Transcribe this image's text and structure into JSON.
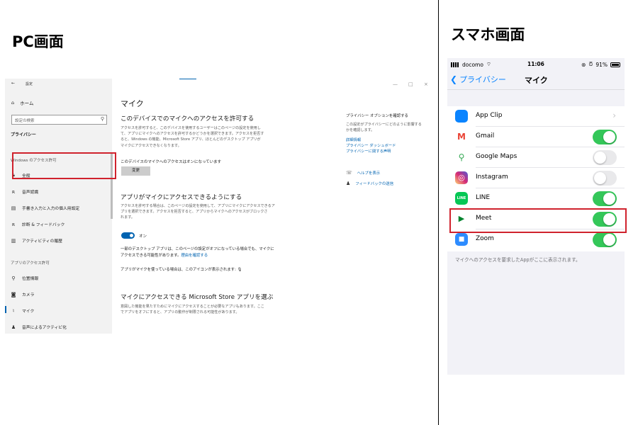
{
  "headings": {
    "pc": "PC画面",
    "smartphone": "スマホ画面"
  },
  "pc": {
    "window_title": "設定",
    "window_controls": {
      "minimize": "—",
      "maximize": "□",
      "close": "×"
    },
    "sidebar": {
      "back": "←",
      "home": "ホーム",
      "search_placeholder": "設定の検索",
      "current": "プライバシー",
      "section_windows": "Windows のアクセス許可",
      "windows_items": [
        {
          "label": "全般",
          "icon": "lock-icon"
        },
        {
          "label": "音声認識",
          "icon": "voice-icon"
        },
        {
          "label": "手書き入力と入力の個人用設定",
          "icon": "handwriting-icon"
        },
        {
          "label": "診断 & フィードバック",
          "icon": "diagnostics-icon"
        },
        {
          "label": "アクティビティの履歴",
          "icon": "history-icon"
        }
      ],
      "section_apps": "アプリのアクセス許可",
      "app_items": [
        {
          "label": "位置情報",
          "icon": "location-icon"
        },
        {
          "label": "カメラ",
          "icon": "camera-icon"
        },
        {
          "label": "マイク",
          "icon": "microphone-icon"
        },
        {
          "label": "音声によるアクティビ化",
          "icon": "voice-activation-icon"
        }
      ]
    },
    "main": {
      "title": "マイク",
      "device_heading": "このデバイスでのマイクへのアクセスを許可する",
      "device_desc": [
        "アクセスを許可すると、このデバイスを使用するユーザーはこのページの設定を使用し",
        "て、アプリにマイクへのアクセスを許可するかどうかを選択できます。アクセスを拒否す",
        "ると、Windows の機能、Microsoft Store アプリ、ほとんどのデスクトップ アプリが",
        "マイクにアクセスできなくなります。"
      ],
      "device_status": "このデバイスのマイクへのアクセスはオンになっています",
      "change_button": "変更",
      "apps_heading": "アプリがマイクにアクセスできるようにする",
      "apps_desc": [
        "アクセスを許可する場合は、このページの設定を使用して、アプリにマイクにアクセスできるア",
        "プリを選択できます。アクセスを拒否すると、アプリからマイクへのアクセスがブロックさ",
        "れます。"
      ],
      "toggle_label": "オン",
      "desktop_note_1": "一部のデスクトップ アプリは、このページの設定がオフになっている場合でも、マイクに",
      "desktop_note_2": "アクセスできる可能性があります。",
      "desktop_note_link": "理由を確認する",
      "icon_note": "アプリがマイクを使っている場合は、このアイコンが表示されます:",
      "store_heading": "マイクにアクセスできる Microsoft Store アプリを選ぶ",
      "store_desc": [
        "意図した機能を果たすためにマイクにアクセスすることが必要なアプリもあります。ここ",
        "でアプリをオフにすると、アプリの動作が制限される可能性があります。"
      ]
    },
    "right_panel": {
      "title": "プライバシー オプションを確認する",
      "desc": [
        "この設定がプライバシーにどのように影響する",
        "かを確認します。"
      ],
      "links": [
        "詳細情報",
        "プライバシー ダッシュボード",
        "プライバシーに関する声明"
      ],
      "help": "ヘルプを表示",
      "feedback": "フィードバックの送信"
    }
  },
  "smartphone": {
    "status": {
      "carrier": "docomo",
      "time": "11:06",
      "battery": "91%"
    },
    "nav": {
      "back": "プライバシー",
      "title": "マイク"
    },
    "apps": [
      {
        "name": "App Clip",
        "type": "link",
        "color": "#0a84ff",
        "icon": "app-clip-icon"
      },
      {
        "name": "Gmail",
        "type": "switch",
        "on": true,
        "color": "#ffffff",
        "icon": "gmail-icon"
      },
      {
        "name": "Google Maps",
        "type": "switch",
        "on": false,
        "color": "#ffffff",
        "icon": "google-maps-icon"
      },
      {
        "name": "Instagram",
        "type": "switch",
        "on": false,
        "color": "#d62976",
        "icon": "instagram-icon"
      },
      {
        "name": "LINE",
        "type": "switch",
        "on": true,
        "color": "#06c755",
        "icon": "line-icon"
      },
      {
        "name": "Meet",
        "type": "switch",
        "on": true,
        "color": "#ffffff",
        "icon": "meet-icon"
      },
      {
        "name": "Zoom",
        "type": "switch",
        "on": true,
        "color": "#2d8cff",
        "icon": "zoom-icon"
      }
    ],
    "footer": "マイクへのアクセスを要求したAppがここに表示されます。"
  }
}
